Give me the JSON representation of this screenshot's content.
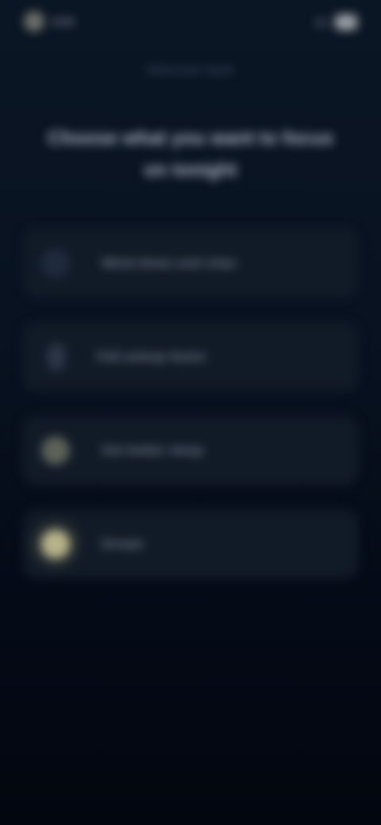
{
  "status_bar": {
    "time": "9:41",
    "right_text": "5G"
  },
  "eyebrow": "Welcome back",
  "headline": "Choose what you want to focus on tonight",
  "options": [
    {
      "label": "Wind down and relax",
      "icon": "moon-icon"
    },
    {
      "label": "Fall asleep faster",
      "icon": "lamp-icon"
    },
    {
      "label": "Get better sleep",
      "icon": "glow-icon"
    },
    {
      "label": "Dream",
      "icon": "light-orb-icon"
    }
  ]
}
